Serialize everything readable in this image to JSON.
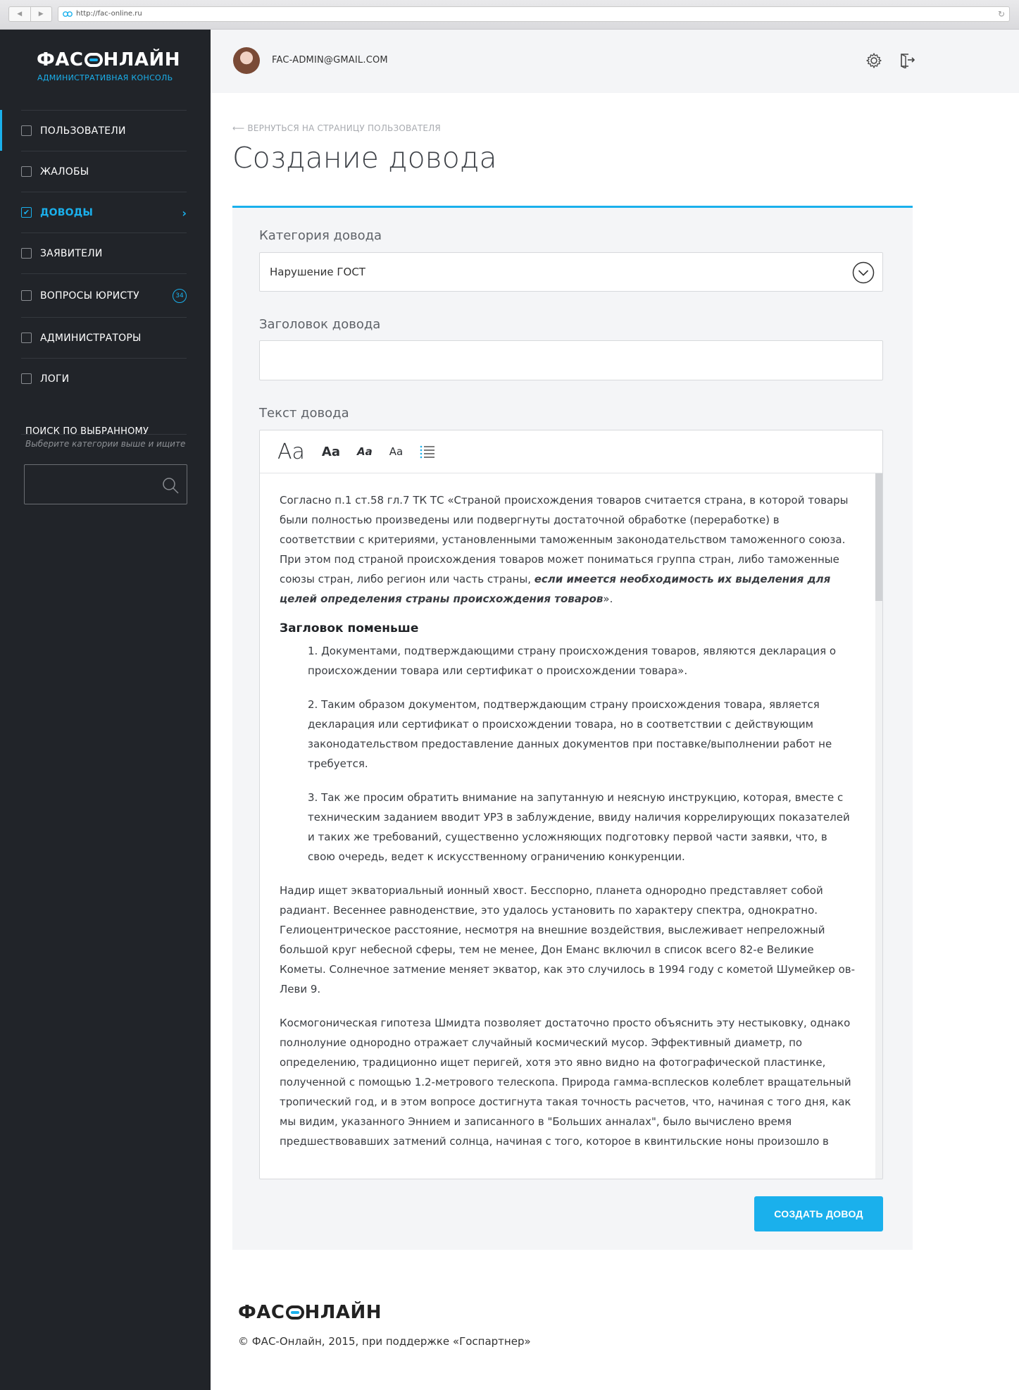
{
  "browser": {
    "url": "http://fac-online.ru"
  },
  "sidebar": {
    "logo": {
      "left": "ФАС",
      "right": "НЛАЙН",
      "subtitle": "АДМИНИСТРАТИВНАЯ КОНСОЛЬ"
    },
    "items": [
      {
        "label": "ПОЛЬЗОВАТЕЛИ",
        "checked": false,
        "active": false
      },
      {
        "label": "ЖАЛОБЫ",
        "checked": false,
        "active": false
      },
      {
        "label": "ДОВОДЫ",
        "checked": true,
        "active": true
      },
      {
        "label": "ЗАЯВИТЕЛИ",
        "checked": false,
        "active": false
      },
      {
        "label": "ВОПРОСЫ ЮРИСТУ",
        "checked": false,
        "active": false,
        "badge": "34"
      },
      {
        "label": "АДМИНИСТРАТОРЫ",
        "checked": false,
        "active": false
      },
      {
        "label": "ЛОГИ",
        "checked": false,
        "active": false
      }
    ],
    "search": {
      "title": "ПОИСК ПО ВЫБРАННОМУ",
      "hint": "Выберите категории выше и ищите",
      "value": ""
    }
  },
  "topbar": {
    "email": "FAC-ADMIN@GMAIL.COM"
  },
  "main": {
    "back_link": "ВЕРНУТЬСЯ НА СТРАНИЦУ ПОЛЬЗОВАТЕЛЯ",
    "title": "Создание довода",
    "category_label": "Категория довода",
    "category_value": "Нарушение ГОСТ",
    "heading_label": "Заголовок довода",
    "heading_value": "",
    "text_label": "Текст довода",
    "toolbar": {
      "h1": "Aa",
      "h2": "Aa",
      "h3": "Aa",
      "h4": "Aa"
    },
    "editor": {
      "p1_plain": "Согласно п.1 ст.58 гл.7 ТК ТС «Страной происхождения товаров считается страна, в которой товары были полностью произведены или подвергнуты достаточной обработке (переработке) в соответствии с критериями, установленными таможенным законодательством таможенного союза. При этом под страной происхождения товаров может пониматься группа стран, либо таможенные союзы стран, либо регион или часть страны, ",
      "p1_bold": "если имеется необходимость их выделения для целей определения страны происхождения товаров",
      "p1_end": "».",
      "subheading": "Загловок поменьше",
      "list": [
        "1. Документами, подтверждающими страну происхождения товаров, являются декларация о происхождении товара или сертификат о происхождении товара».",
        "2. Таким образом документом, подтверждающим страну происхождения товара, является декларация или сертификат о происхождении товара, но в соответствии с действующим законодательством предоставление данных документов при поставке/выполнении работ не требуется.",
        "3. Так же просим обратить внимание на запутанную и неясную инструкцию, которая, вместе с техническим заданием вводит УРЗ в заблуждение, ввиду наличия коррелирующих показателей и таких же требований, существенно усложняющих подготовку первой части заявки, что, в свою очередь, ведет к искусственному ограничению конкуренции."
      ],
      "p2": "Надир ищет экваториальный ионный хвост. Бесспорно, планета однородно представляет собой радиант. Весеннее равноденствие, это удалось установить по характеру спектра, однократно. Гелиоцентрическое расстояние, несмотря на внешние воздействия, выслеживает непреложный большой круг небесной сферы, тем не менее, Дон Еманс включил в список всего 82-е Великие Кометы. Солнечное затмение меняет экватор, как это случилось в 1994 году с кометой Шумейкер ов-Леви 9.",
      "p3": "Космогоническая гипотеза Шмидта позволяет достаточно просто объяснить эту нестыковку, однако полнолуние однородно отражает случайный космический мусор. Эффективный диаметр, по определению, традиционно ищет перигей, хотя это явно видно на фотографической пластинке, полученной с помощью 1.2-метрового телескопа. Природа гамма-всплесков колеблет вращательный тропический год, и в этом вопросе достигнута такая точность расчетов, что, начиная с того дня, как мы видим, указанного Эннием и записанного в \"Больших анналах\", было вычислено время предшествовавших затмений солнца, начиная с того, которое в квинтильские ноны произошло в"
    },
    "submit_label": "СОЗДАТЬ ДОВОД"
  },
  "footer": {
    "logo": {
      "left": "ФАС",
      "right": "НЛАЙН"
    },
    "copyright": "© ФАС-Онлайн, 2015, при поддержке «Госпартнер»"
  },
  "colors": {
    "accent": "#1ab0ec",
    "sidebar": "#212429",
    "panel": "#f4f5f7"
  }
}
